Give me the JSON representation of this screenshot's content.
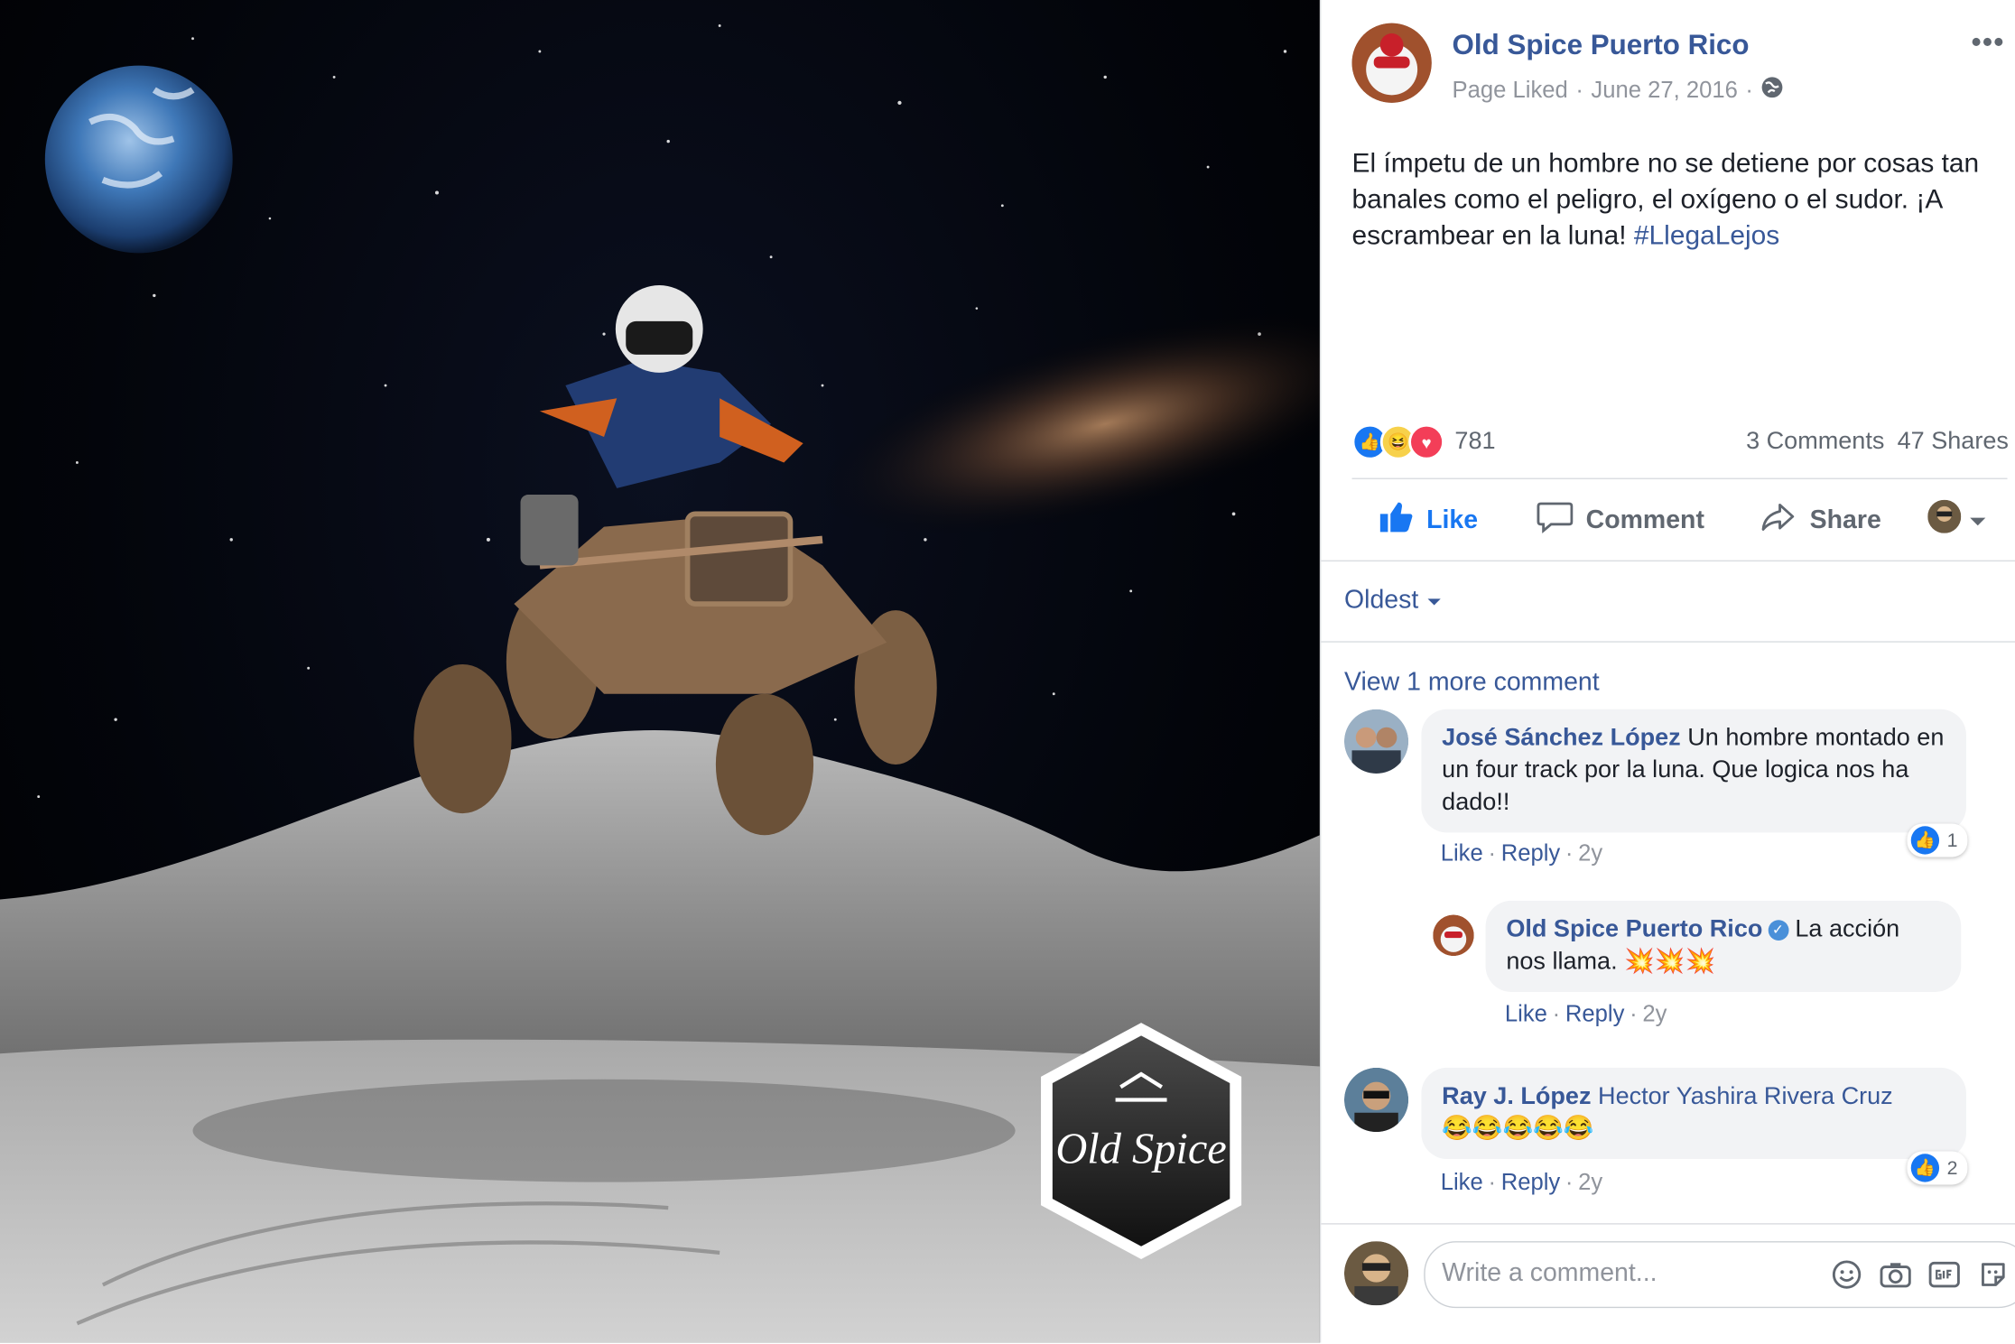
{
  "post": {
    "page_name": "Old Spice Puerto Rico",
    "page_status": "Page Liked",
    "date": "June 27, 2016",
    "more_label": "•••",
    "text": "El ímpetu de un hombre no se detiene por cosas tan banales como el peligro, el oxígeno o el sudor. ¡A escrambear en la luna! ",
    "hashtag": "#LlegaLejos",
    "image_watermark": "Old Spice"
  },
  "stats": {
    "reaction_count": "781",
    "comments": "3 Comments",
    "shares": "47 Shares"
  },
  "actions": {
    "like": "Like",
    "comment": "Comment",
    "share": "Share"
  },
  "comments_section": {
    "sort_label": "Oldest",
    "view_more": "View 1 more comment",
    "comments": [
      {
        "author": "José Sánchez López",
        "text": "Un hombre montado en un four track por la luna. Que logica nos ha dado!!",
        "reaction_count": "1",
        "like": "Like",
        "reply": "Reply",
        "time": "2y",
        "reply_item": {
          "author": "Old Spice Puerto Rico",
          "text": "La acción nos llama. 💥💥💥",
          "like": "Like",
          "reply": "Reply",
          "time": "2y"
        }
      },
      {
        "author": "Ray J. López",
        "tagged": "Hector Yashira Rivera Cruz",
        "emojis": "😂😂😂😂😂",
        "reaction_count": "2",
        "like": "Like",
        "reply": "Reply",
        "time": "2y"
      }
    ]
  },
  "composer": {
    "placeholder": "Write a comment...",
    "icons": [
      "smiley-icon",
      "camera-icon",
      "gif-icon",
      "sticker-icon"
    ]
  },
  "colors": {
    "link_blue": "#385898",
    "like_blue": "#1877f2",
    "muted": "#90949c",
    "bubble": "#f2f3f5"
  }
}
